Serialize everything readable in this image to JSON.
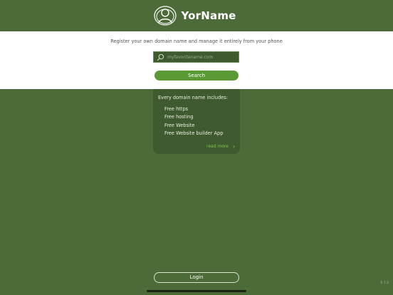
{
  "header": {
    "brand": "YorName",
    "logo_icon": "person-circle-logo-icon"
  },
  "main": {
    "tagline": "Register your own domain name and manage it entirely from your phone",
    "search": {
      "placeholder": "myfavoritename.com",
      "value": "",
      "icon": "search-icon",
      "button_label": "Search"
    }
  },
  "info_card": {
    "title": "Every domain name includes:",
    "features": [
      "Free https",
      "Free hosting",
      "Free Website",
      "Free Website builder App"
    ],
    "read_more": "read more",
    "read_more_icon": "chevron-right-icon"
  },
  "footer": {
    "login_label": "Login",
    "version": "0.7.2"
  },
  "colors": {
    "background": "#4c6b38",
    "card": "#3f5a2e",
    "accent": "#5a9a35",
    "link": "#7cc84a"
  }
}
